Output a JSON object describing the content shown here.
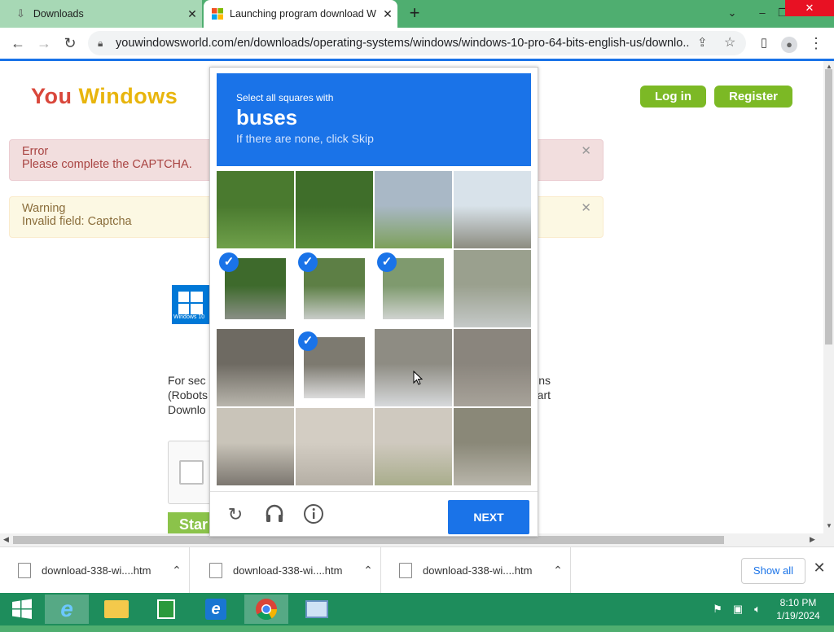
{
  "browser": {
    "tabs": [
      {
        "title": "Downloads",
        "icon": "download-icon"
      },
      {
        "title": "Launching program download W",
        "icon": "windows-icon"
      }
    ],
    "url": "youwindowsworld.com/en/downloads/operating-systems/windows/windows-10-pro-64-bits-english-us/downlo..."
  },
  "page": {
    "logo_part1": "You",
    "logo_part2": "Windows",
    "login": "Log in",
    "register": "Register",
    "error_title": "Error",
    "error_text": "Please complete the CAPTCHA.",
    "warning_title": "Warning",
    "warning_text": "Invalid field: Captcha",
    "win_logo_text": "Windows 10",
    "body_line1_left": "For sec",
    "body_line1_right": "ns",
    "body_line2_left": "(Robots",
    "body_line2_right": "art",
    "body_line3_left": "Downlo",
    "start_button": "Star"
  },
  "captcha": {
    "select_text": "Select all squares with",
    "target": "buses",
    "skip_text": "If there are none, click Skip",
    "next_label": "NEXT",
    "tiles": [
      {
        "selected": false,
        "bg": "#4a7a2f",
        "fg": "#6fa04a"
      },
      {
        "selected": false,
        "bg": "#3f6e2a",
        "fg": "#5c8f3c"
      },
      {
        "selected": false,
        "bg": "#a9b8c6",
        "fg": "#7da05a"
      },
      {
        "selected": false,
        "bg": "#d8e2ea",
        "fg": "#8c8c80"
      },
      {
        "selected": true,
        "bg": "#3e6a2c",
        "fg": "#8a8f86"
      },
      {
        "selected": true,
        "bg": "#5d7f45",
        "fg": "#c9ccc9"
      },
      {
        "selected": true,
        "bg": "#7f9a6e",
        "fg": "#d0d3d0"
      },
      {
        "selected": false,
        "bg": "#9aa08e",
        "fg": "#c5c9c8"
      },
      {
        "selected": false,
        "bg": "#6e6a62",
        "fg": "#b9b6ad"
      },
      {
        "selected": true,
        "bg": "#7d7a70",
        "fg": "#dcdcdc"
      },
      {
        "selected": false,
        "bg": "#8e8c83",
        "fg": "#d7d9db"
      },
      {
        "selected": false,
        "bg": "#8a857d",
        "fg": "#a8a39a"
      },
      {
        "selected": false,
        "bg": "#c9c4b9",
        "fg": "#7c7770"
      },
      {
        "selected": false,
        "bg": "#d3cdc3",
        "fg": "#b5afa5"
      },
      {
        "selected": false,
        "bg": "#cfc9bf",
        "fg": "#a9ad8c"
      },
      {
        "selected": false,
        "bg": "#8a8878",
        "fg": "#b8b5aa"
      }
    ]
  },
  "downloads": {
    "items": [
      "download-338-wi....htm",
      "download-338-wi....htm",
      "download-338-wi....htm"
    ],
    "show_all": "Show all"
  },
  "taskbar": {
    "time": "8:10 PM",
    "date": "1/19/2024"
  },
  "colors": {
    "accent": "#1a73e8",
    "green_button": "#7cb925",
    "taskbar": "#1e8d5c"
  }
}
